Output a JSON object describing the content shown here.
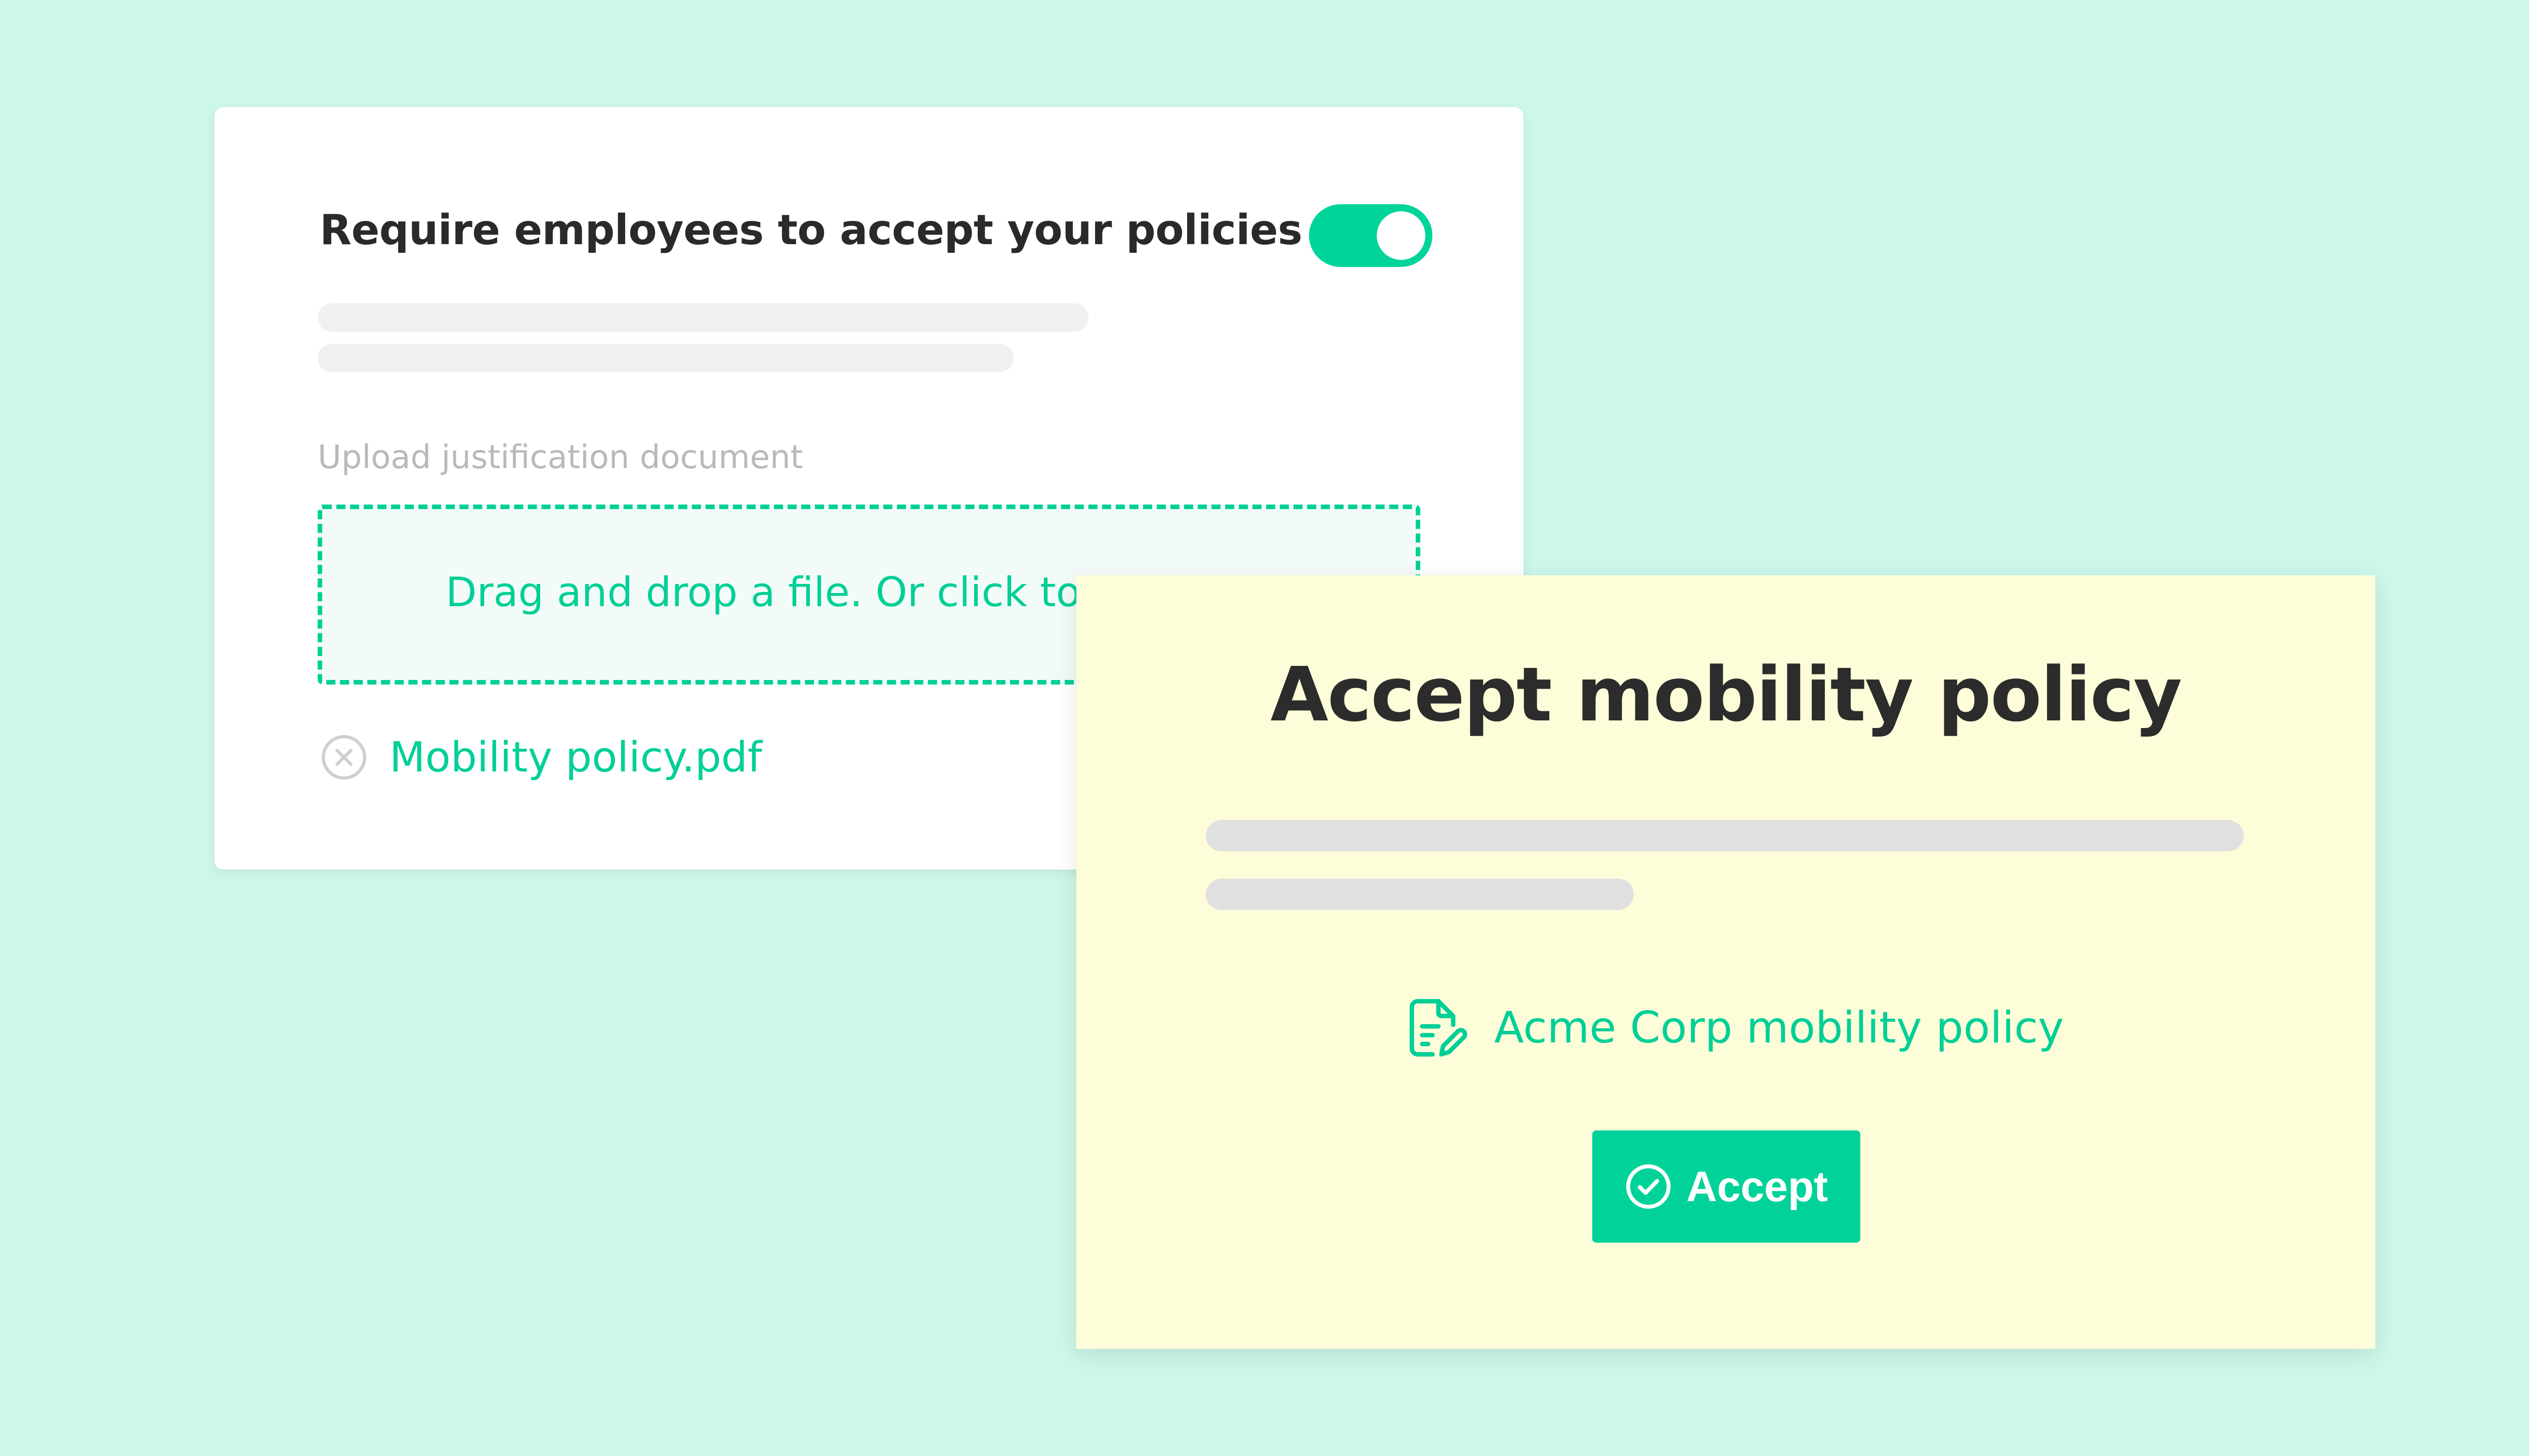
{
  "settings_card": {
    "title": "Require employees to accept your policies",
    "toggle_state": "on",
    "upload_label": "Upload justification document",
    "dropzone_text": "Drag and drop a file. Or click to",
    "file": {
      "name": "Mobility policy.pdf",
      "remove_icon": "circle-x-icon"
    }
  },
  "accept_modal": {
    "title": "Accept mobility policy",
    "policy_link": {
      "icon": "document-edit-icon",
      "label": "Acme Corp mobility policy"
    },
    "accept_button": {
      "icon": "check-circle-icon",
      "label": "Accept"
    }
  },
  "colors": {
    "background": "#cdf7ea",
    "accent": "#00d49b",
    "modal_background": "#fefdd9",
    "title_text": "#2a2a2a",
    "muted_text": "#b9b9b9",
    "placeholder_bar": "#f0f0f0"
  }
}
